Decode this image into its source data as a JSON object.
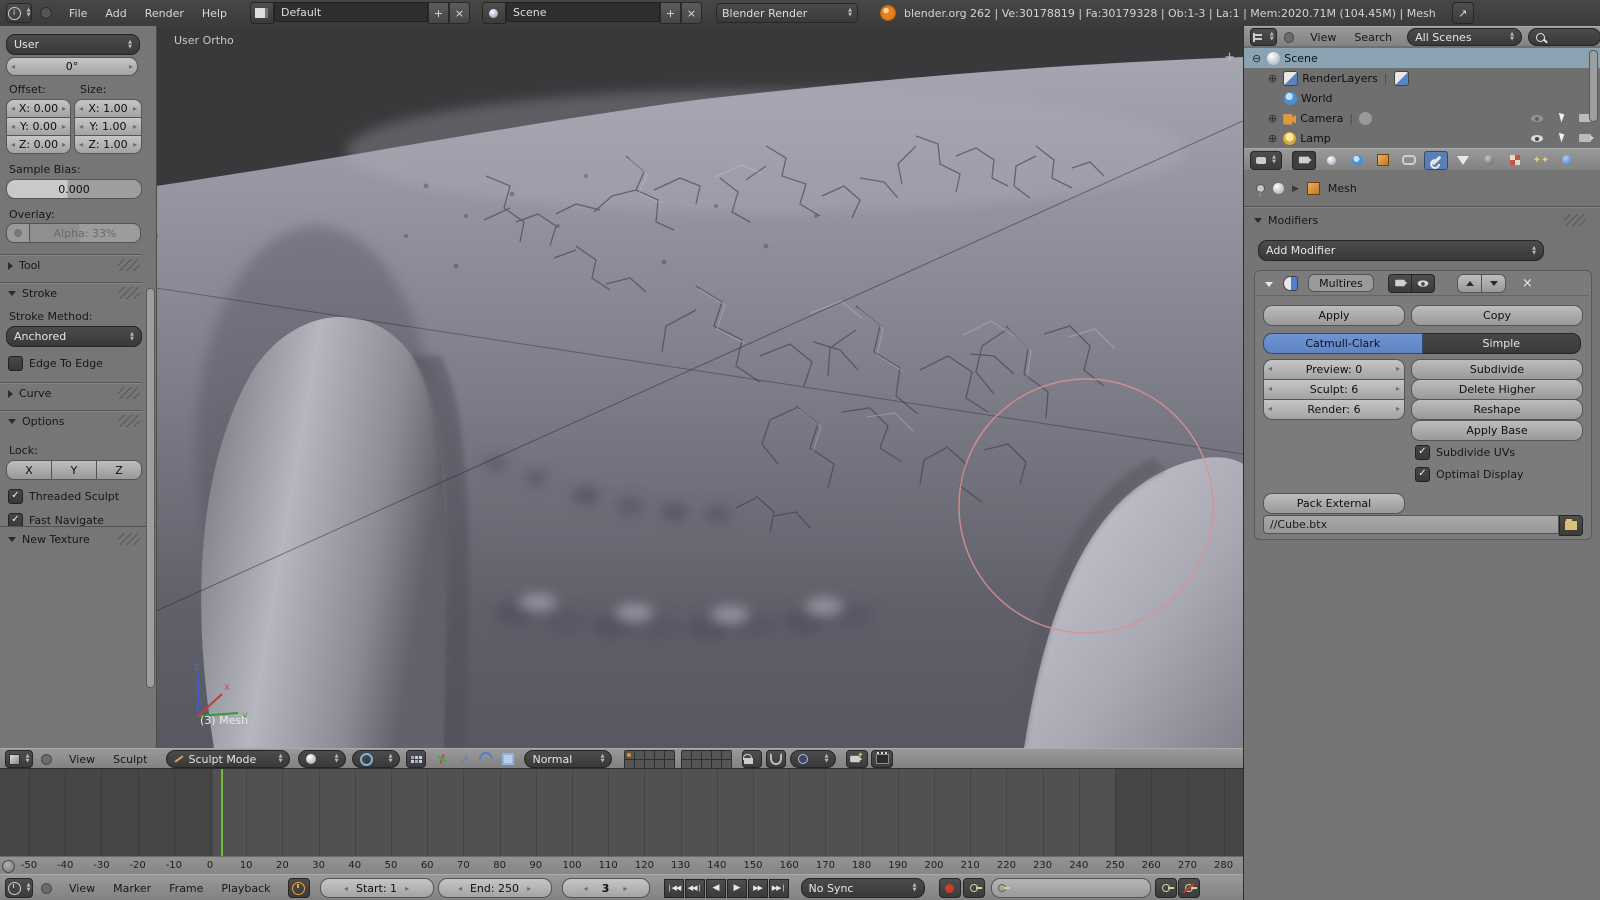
{
  "icons": {
    "check": "✓",
    "close": "×",
    "plus": "+",
    "minus": "⊖",
    "plus_circle": "⊕",
    "tri_down": "▼",
    "tri_right": "▶",
    "arrow_ne": "↗",
    "dot": "●"
  },
  "topbar": {
    "menus": [
      "File",
      "Add",
      "Render",
      "Help"
    ],
    "layout_name": "Default",
    "scene_name": "Scene",
    "engine": "Blender Render",
    "stats": "blender.org 262 | Ve:30178819 | Fa:30179328 | Ob:1-3 | La:1 | Mem:2020.71M (104.45M) | Mesh"
  },
  "tool_shelf": {
    "view_mode": "User",
    "angle": "0°",
    "offset_label": "Offset:",
    "size_label": "Size:",
    "offset_fields": [
      "X: 0.00",
      "Y: 0.00",
      "Z: 0.00"
    ],
    "size_fields": [
      "X: 1.00",
      "Y: 1.00",
      "Z: 1.00"
    ],
    "sample_bias_label": "Sample Bias:",
    "sample_bias_value": "0.000",
    "overlay_label": "Overlay:",
    "overlay_alpha": "Alpha: 33%",
    "tool_panel": "Tool",
    "stroke_panel": "Stroke",
    "stroke_method_label": "Stroke Method:",
    "stroke_method": "Anchored",
    "edge_to_edge": "Edge To Edge",
    "curve_panel": "Curve",
    "options_panel": "Options",
    "lock_label": "Lock:",
    "lock_axes": [
      "X",
      "Y",
      "Z"
    ],
    "threaded_sculpt": "Threaded Sculpt",
    "fast_navigate": "Fast Navigate",
    "new_texture_panel": "New Texture"
  },
  "viewport": {
    "view_label": "User Ortho",
    "object_label": "(3) Mesh",
    "axis_x": "x",
    "axis_y": "y",
    "axis_z": "z"
  },
  "view3d_header": {
    "menus": [
      "View",
      "Sculpt"
    ],
    "mode": "Sculpt Mode",
    "orientation": "Normal"
  },
  "outliner": {
    "menus": [
      "View",
      "Search"
    ],
    "filter": "All Scenes",
    "items": [
      {
        "label": "Scene"
      },
      {
        "label": "RenderLayers"
      },
      {
        "label": "World"
      },
      {
        "label": "Camera"
      },
      {
        "label": "Lamp"
      }
    ]
  },
  "properties": {
    "breadcrumb": "Mesh",
    "panel_title": "Modifiers",
    "add_modifier": "Add Modifier",
    "modifier_name": "Multires",
    "apply": "Apply",
    "copy": "Copy",
    "subdiv_type_active": "Catmull-Clark",
    "subdiv_type_inactive": "Simple",
    "levels": [
      "Preview: 0",
      "Sculpt: 6",
      "Render: 6"
    ],
    "buttons": [
      "Subdivide",
      "Delete Higher",
      "Reshape",
      "Apply Base"
    ],
    "checkboxes": [
      "Subdivide UVs",
      "Optimal Display"
    ],
    "pack_external": "Pack External",
    "filepath": "//Cube.btx"
  },
  "timeline": {
    "menus": [
      "View",
      "Marker",
      "Frame",
      "Playback"
    ],
    "start": "Start: 1",
    "end": "End: 250",
    "current": "3",
    "sync": "No Sync",
    "current_frame": 3,
    "playback": [
      "❘◀◀",
      "◀◀❘",
      "◀",
      "▶",
      "▶▶",
      "▶▶❘"
    ],
    "ruler": [
      -50,
      -40,
      -30,
      -20,
      -10,
      0,
      10,
      20,
      30,
      40,
      50,
      60,
      70,
      80,
      90,
      100,
      110,
      120,
      130,
      140,
      150,
      160,
      170,
      180,
      190,
      200,
      210,
      220,
      230,
      240,
      250,
      260,
      270,
      280
    ]
  },
  "colors": {
    "accent_blue": "#5d84c4",
    "current_frame_green": "#6cbe30",
    "brush_cursor_pink": "#dc8f8f",
    "active_tab_blue": "#5a7fb5"
  }
}
